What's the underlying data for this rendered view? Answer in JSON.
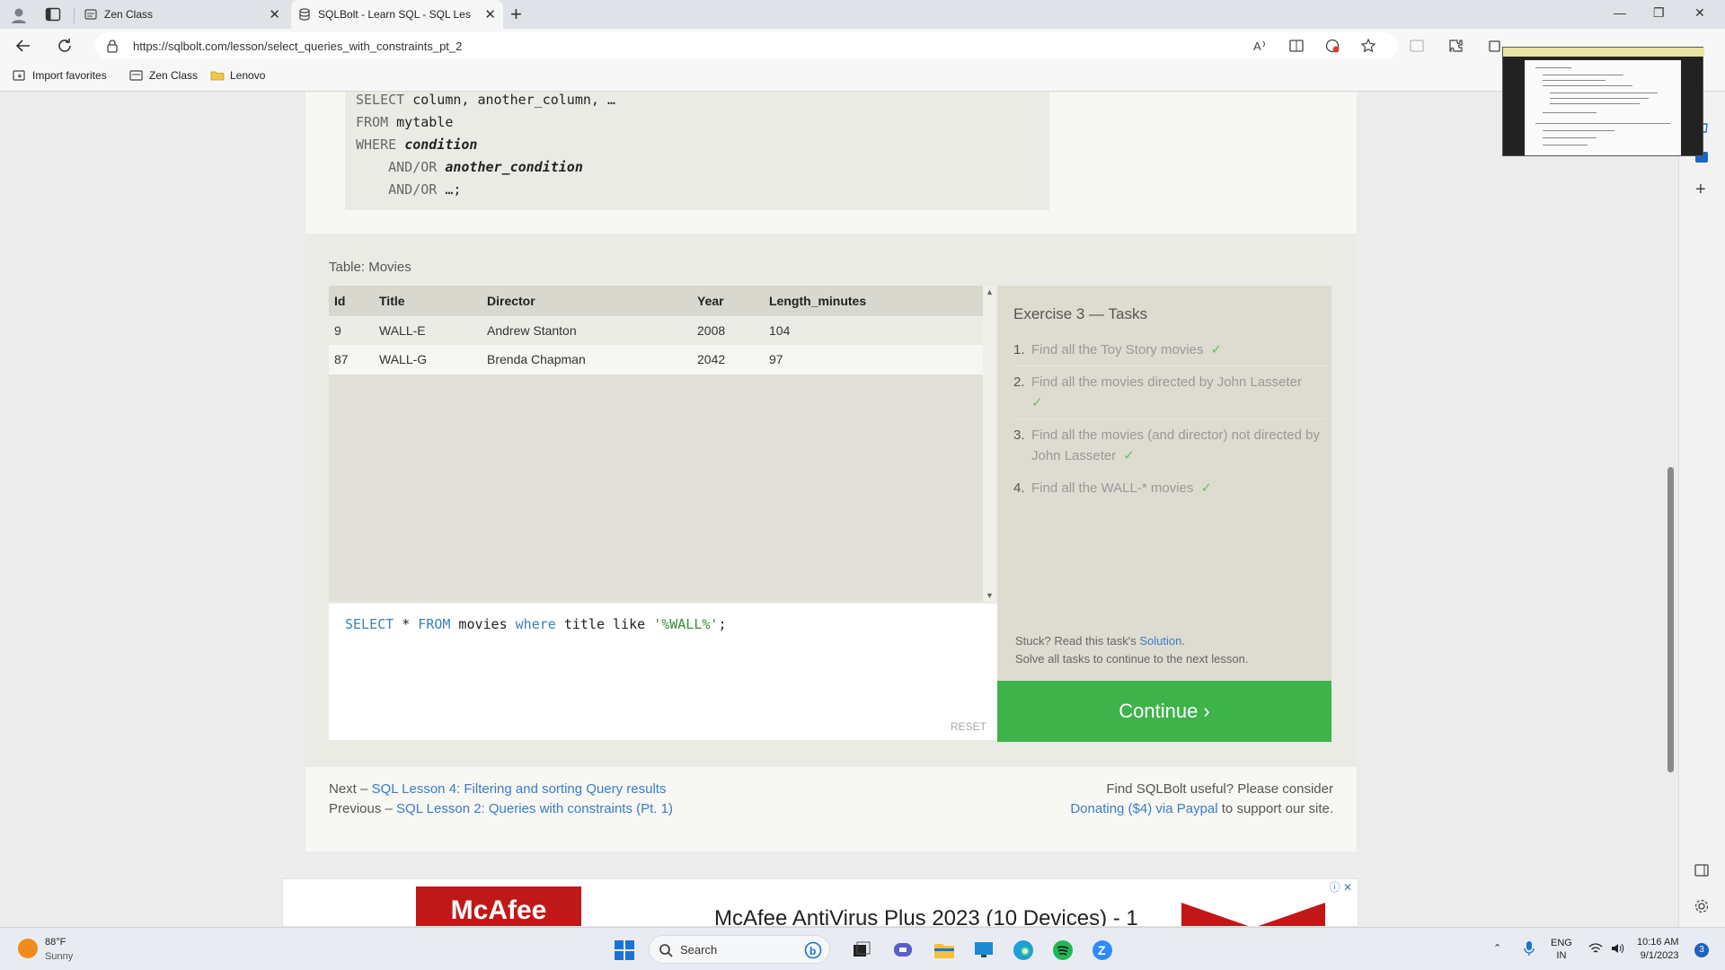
{
  "browser": {
    "tabs": [
      {
        "label": "Zen Class",
        "active": false
      },
      {
        "label": "SQLBolt - Learn SQL - SQL Lesso",
        "active": true
      }
    ],
    "url": "https://sqlbolt.com/lesson/select_queries_with_constraints_pt_2",
    "favorites": [
      "Import favorites",
      "Zen Class",
      "Lenovo"
    ]
  },
  "lesson": {
    "code_lines": [
      {
        "kw": "SELECT",
        "rest": " column, another_column, …",
        "em": ""
      },
      {
        "kw": "FROM",
        "rest": " mytable",
        "em": ""
      },
      {
        "kw": "WHERE",
        "rest": " ",
        "em": "condition"
      },
      {
        "kw": "    AND/OR",
        "rest": " ",
        "em": "another_condition"
      },
      {
        "kw": "    AND/OR",
        "rest": " …;",
        "em": ""
      }
    ],
    "table_caption": "Table: Movies",
    "columns": [
      "Id",
      "Title",
      "Director",
      "Year",
      "Length_minutes"
    ],
    "rows": [
      [
        "9",
        "WALL-E",
        "Andrew Stanton",
        "2008",
        "104"
      ],
      [
        "87",
        "WALL-G",
        "Brenda Chapman",
        "2042",
        "97"
      ]
    ],
    "query": {
      "select_kw": "SELECT",
      "star": " * ",
      "from_kw": "FROM",
      "table": " movies ",
      "where_kw": "where",
      "cond": " title like ",
      "value": "'%WALL%'",
      "end": ";"
    },
    "reset_label": "RESET",
    "exercise_title": "Exercise 3 — Tasks",
    "tasks": [
      {
        "num": "1.",
        "text": "Find all the Toy Story movies",
        "check": "✓"
      },
      {
        "num": "2.",
        "text": "Find all the movies directed by John Lasseter",
        "check": "✓"
      },
      {
        "num": "3.",
        "text": "Find all the movies (and director) not directed by John Lasseter",
        "check": "✓"
      },
      {
        "num": "4.",
        "text": "Find all the WALL-* movies",
        "check": "✓"
      }
    ],
    "stuck_prefix": "Stuck? Read this task's ",
    "stuck_link": "Solution",
    "stuck_suffix": ".",
    "solve_all": "Solve all tasks to continue to the next lesson.",
    "continue_label": "Continue ›",
    "next_prefix": "Next – ",
    "next_link": "SQL Lesson 4: Filtering and sorting Query results",
    "prev_prefix": "Previous – ",
    "prev_link": "SQL Lesson 2: Queries with constraints (Pt. 1)",
    "useful_text": "Find SQLBolt useful? Please consider",
    "donate_link": "Donating ($4) via Paypal",
    "donate_suffix": " to support our site."
  },
  "ad": {
    "brand": "McAfee",
    "title": "McAfee AntiVirus Plus 2023 (10 Devices) - 1",
    "info": "ⓘ ✕"
  },
  "taskbar": {
    "temp": "88°F",
    "condition": "Sunny",
    "search_label": "Search",
    "lang_top": "ENG",
    "lang_bottom": "IN",
    "time": "10:16 AM",
    "date": "9/1/2023",
    "notification_count": "3"
  },
  "colors": {
    "continue_bg": "#3db34a",
    "link": "#3d7cc4",
    "check": "#6bc06b"
  }
}
